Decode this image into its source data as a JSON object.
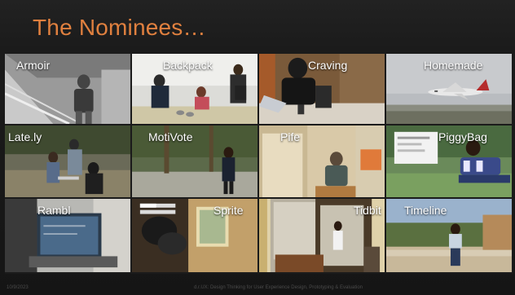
{
  "slide": {
    "title": "The Nominees…",
    "accent_color": "#e0803f"
  },
  "nominees": [
    {
      "name": "Armoir"
    },
    {
      "name": "Backpack"
    },
    {
      "name": "Craving"
    },
    {
      "name": "Homemade"
    },
    {
      "name": "Late.ly"
    },
    {
      "name": "MotiVote"
    },
    {
      "name": "Pife"
    },
    {
      "name": "PiggyBag"
    },
    {
      "name": "Rambl"
    },
    {
      "name": "Sprite"
    },
    {
      "name": "Tidbit"
    },
    {
      "name": "Timeline"
    }
  ],
  "footer": {
    "date": "10/9/2023",
    "course": "d.r.UX: Design Thinking for User Experience Design, Prototyping & Evaluation"
  }
}
